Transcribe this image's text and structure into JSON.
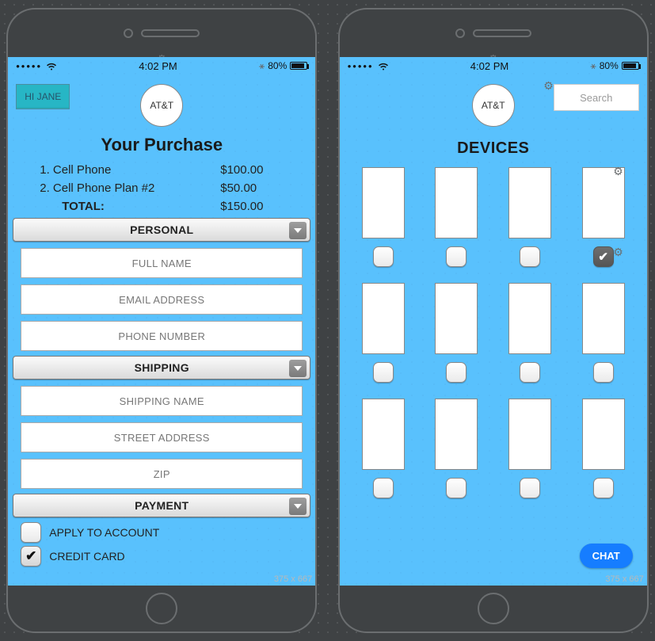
{
  "statusbar": {
    "time": "4:02 PM",
    "battery": "80%"
  },
  "brand": "AT&T",
  "screen1": {
    "greeting": "HI JANE",
    "title": "Your Purchase",
    "items": [
      {
        "label": "1. Cell Phone",
        "price": "$100.00"
      },
      {
        "label": "2. Cell Phone Plan #2",
        "price": "$50.00"
      }
    ],
    "total_label": "TOTAL:",
    "total_price": "$150.00",
    "sections": {
      "personal": {
        "header": "PERSONAL",
        "fields": [
          "FULL NAME",
          "EMAIL ADDRESS",
          "PHONE NUMBER"
        ]
      },
      "shipping": {
        "header": "SHIPPING",
        "fields": [
          "SHIPPING NAME",
          "STREET ADDRESS",
          "ZIP"
        ]
      },
      "payment": {
        "header": "PAYMENT",
        "options": [
          {
            "label": "APPLY TO ACCOUNT",
            "checked": false
          },
          {
            "label": "CREDIT CARD",
            "checked": true
          }
        ]
      }
    }
  },
  "screen2": {
    "search_placeholder": "Search",
    "title": "DEVICES",
    "chat_label": "CHAT",
    "selection": [
      [
        false,
        false,
        false,
        true
      ],
      [
        false,
        false,
        false,
        false
      ],
      [
        false,
        false,
        false,
        false
      ]
    ]
  },
  "dims": "375 x 667"
}
